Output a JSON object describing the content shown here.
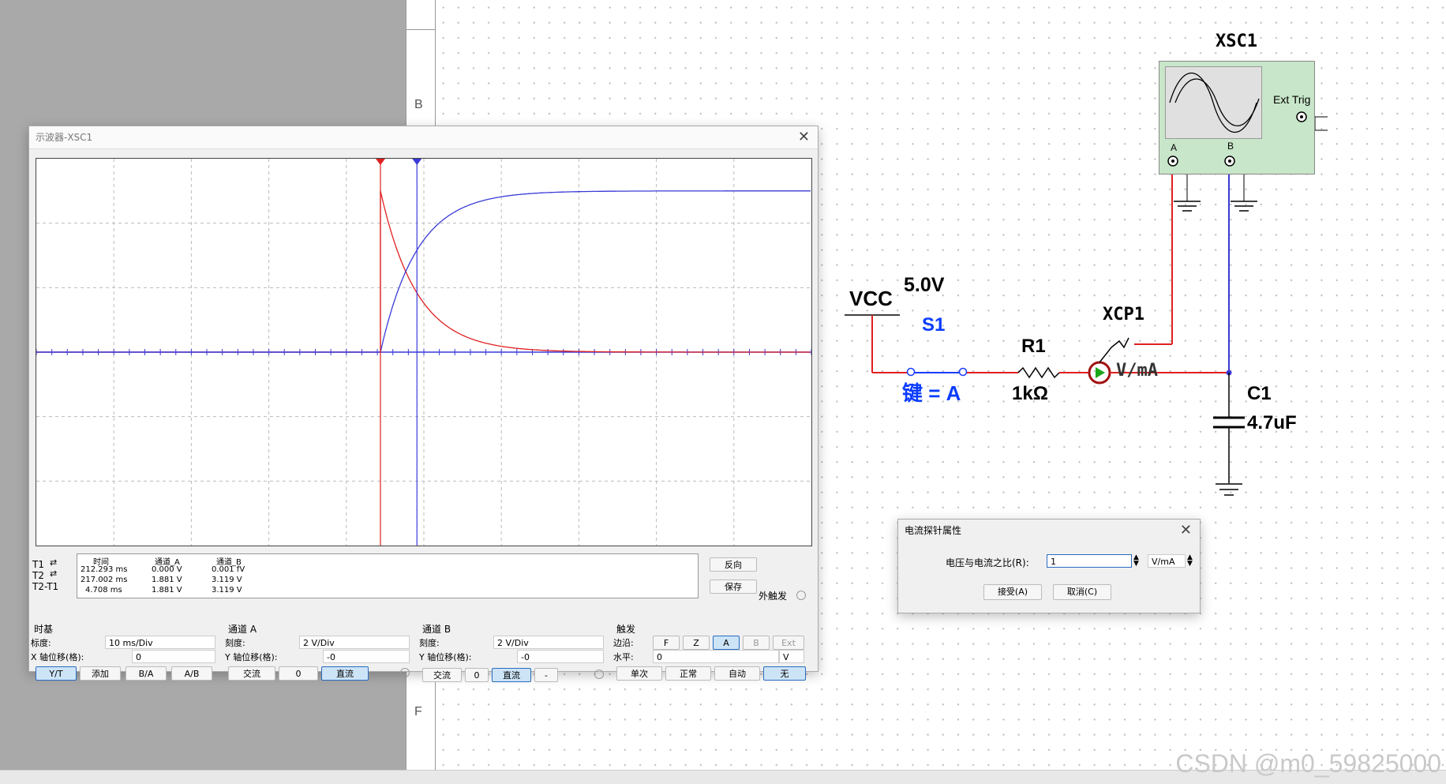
{
  "workspace": {
    "zone_letters": [
      "B",
      "F"
    ],
    "watermark": "CSDN @m0_59825000"
  },
  "schematic": {
    "vcc_label": "VCC",
    "vcc_value": "5.0V",
    "switch_name": "S1",
    "switch_key": "键 = A",
    "resistor_name": "R1",
    "resistor_value": "1kΩ",
    "probe_name": "XCP1",
    "probe_unit": "V/mA",
    "capacitor_name": "C1",
    "capacitor_value": "4.7uF",
    "scope_name": "XSC1",
    "scope_ext_trig": "Ext Trig",
    "scope_pin_a": "A",
    "scope_pin_b": "B",
    "wire_colors": {
      "channel_a": "#e02020",
      "channel_b": "#3a3ad8",
      "switch": "#1a3cff"
    }
  },
  "scope_window": {
    "title": "示波器-XSC1",
    "chart_data": {
      "type": "line",
      "x_unit": "ms",
      "y_unit": "V",
      "x_div": "10 ms/Div",
      "y_div_a": "2 V/Div",
      "y_div_b": "2 V/Div",
      "grid": true,
      "series": [
        {
          "name": "通道_A",
          "color": "#e02020",
          "shape": "decay",
          "peak": 5.0,
          "final": 0.0,
          "tau_ms": 4.7
        },
        {
          "name": "通道_B",
          "color": "#3a3ad8",
          "shape": "charge",
          "peak": 0.0,
          "final": 5.0,
          "tau_ms": 4.7
        }
      ],
      "cursor_t1_ms": 212.293,
      "cursor_t2_ms": 217.002
    },
    "readout": {
      "headers": [
        "时间",
        "通道_A",
        "通道_B"
      ],
      "rows": [
        {
          "label": "T1",
          "time": "212.293 ms",
          "a": "0.000 V",
          "b": "0.001 fV"
        },
        {
          "label": "T2",
          "time": "217.002 ms",
          "a": "1.881 V",
          "b": "3.119 V"
        },
        {
          "label": "T2-T1",
          "time": "4.708 ms",
          "a": "1.881 V",
          "b": "3.119 V"
        }
      ]
    },
    "buttons": {
      "reverse": "反向",
      "save": "保存",
      "ext_trigger": "外触发"
    },
    "timebase": {
      "group": "时基",
      "scale_label": "标度:",
      "scale_value": "10 ms/Div",
      "xpos_label": "X 轴位移(格):",
      "xpos_value": "0",
      "modes": [
        "Y/T",
        "添加",
        "B/A",
        "A/B"
      ]
    },
    "channel_a": {
      "group": "通道 A",
      "scale_label": "刻度:",
      "scale_value": "2 V/Div",
      "ypos_label": "Y 轴位移(格):",
      "ypos_value": "-0",
      "coupling": [
        "交流",
        "0",
        "直流"
      ]
    },
    "channel_b": {
      "group": "通道 B",
      "scale_label": "刻度:",
      "scale_value": "2 V/Div",
      "ypos_label": "Y 轴位移(格):",
      "ypos_value": "-0",
      "coupling": [
        "交流",
        "0",
        "直流",
        "-"
      ]
    },
    "trigger": {
      "group": "触发",
      "edge_label": "边沿:",
      "edge_buttons": [
        "F",
        "Z",
        "A",
        "B",
        "Ext"
      ],
      "level_label": "水平:",
      "level_value": "0",
      "level_unit": "V",
      "modes": [
        "单次",
        "正常",
        "自动",
        "无"
      ]
    }
  },
  "probe_dialog": {
    "title": "电流探针属性",
    "ratio_label": "电压与电流之比(R):",
    "ratio_value": "1",
    "ratio_unit": "V/mA",
    "ok_label": "接受(A)",
    "cancel_label": "取消(C)"
  }
}
